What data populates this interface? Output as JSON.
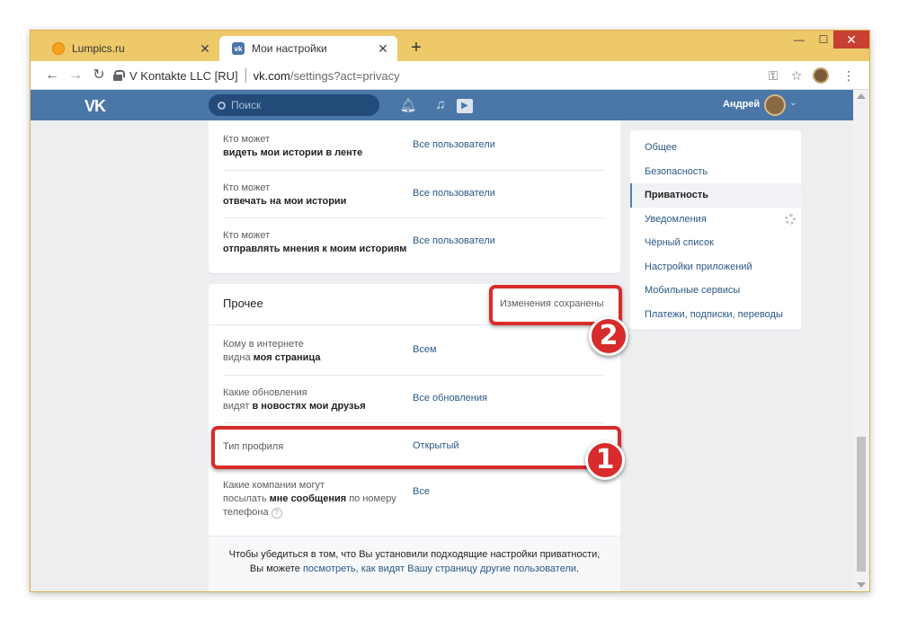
{
  "browser": {
    "tabs": [
      {
        "title": "Lumpics.ru",
        "close": "✕"
      },
      {
        "title": "Мои настройки",
        "close": "✕"
      }
    ],
    "new_tab": "+",
    "window_controls": {
      "minimize": "—",
      "maximize": "☐",
      "close": "✕"
    },
    "nav": {
      "back": "←",
      "forward": "→",
      "reload": "↻"
    },
    "omnibox": {
      "site_name": "V Kontakte LLC [RU]",
      "host": "vk.com",
      "path": "/settings?act=privacy"
    },
    "icons": {
      "key": "key-icon",
      "star": "star-icon",
      "menu": "kebab-menu-icon"
    }
  },
  "vk": {
    "logo": "VK",
    "search_placeholder": "Поиск",
    "user_name": "Андрей",
    "icons": [
      "bell-icon",
      "music-icon",
      "video-icon"
    ]
  },
  "privacy_rows_top": [
    {
      "label_normal": "Кто может",
      "label_bold": "видеть мои истории в ленте",
      "value": "Все пользователи"
    },
    {
      "label_normal": "Кто может",
      "label_bold": "отвечать на мои истории",
      "value": "Все пользователи"
    },
    {
      "label_normal": "Кто может",
      "label_bold": "отправлять мнения к моим историям",
      "value": "Все пользователи"
    }
  ],
  "other_section": {
    "title": "Прочее",
    "saved_notice": "Изменения сохранены",
    "rows": [
      {
        "line1": "Кому в интернете",
        "line2_normal": "видна ",
        "line2_bold": "моя страница",
        "value": "Всем"
      },
      {
        "line1": "Какие обновления",
        "line2_normal": "видят ",
        "line2_bold": "в новостях мои друзья",
        "value": "Все обновления"
      },
      {
        "line1": "Тип профиля",
        "value": "Открытый"
      },
      {
        "line1": "Какие компании могут",
        "line2_normal": "посылать ",
        "line2_bold": "мне сообщения",
        "line2_tail": " по номеру",
        "line3": "телефона",
        "help": "?",
        "value": "Все"
      }
    ],
    "footer_line1": "Чтобы убедиться в том, что Вы установили подходящие настройки приватности,",
    "footer_line2_prefix": "Вы можете ",
    "footer_link": "посмотреть, как видят Вашу страницу другие пользователи",
    "footer_line2_suffix": "."
  },
  "settings_menu": [
    {
      "label": "Общее"
    },
    {
      "label": "Безопасность"
    },
    {
      "label": "Приватность",
      "active": true
    },
    {
      "label": "Уведомления"
    },
    {
      "label": "Чёрный список"
    },
    {
      "label": "Настройки приложений"
    },
    {
      "label": "Мобильные сервисы"
    },
    {
      "label": "Платежи, подписки, переводы"
    }
  ],
  "annotations": {
    "badge1": "1",
    "badge2": "2",
    "accent": "#d82b2b"
  },
  "colors": {
    "vk_blue": "#4a76a8",
    "link": "#2a5885",
    "window_frame": "#edc96a"
  }
}
